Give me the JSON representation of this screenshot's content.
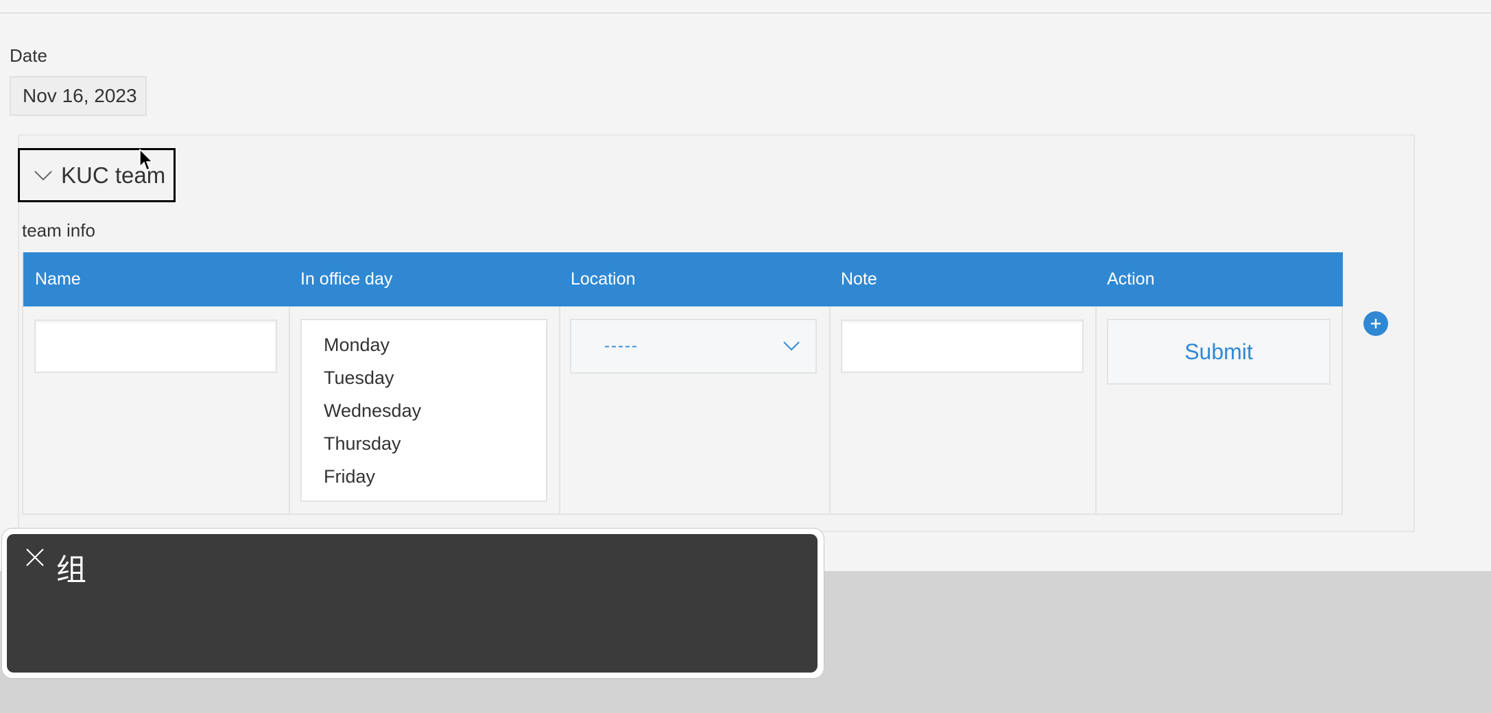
{
  "form": {
    "date_label": "Date",
    "date_value": "Nov 16, 2023"
  },
  "group": {
    "title": "KUC team",
    "expanded": true,
    "section_label": "team info"
  },
  "table": {
    "headers": [
      "Name",
      "In office day",
      "Location",
      "Note",
      "Action"
    ],
    "row": {
      "name_value": "",
      "office_day_options": [
        "Monday",
        "Tuesday",
        "Wednesday",
        "Thursday",
        "Friday"
      ],
      "location_selected": "-----",
      "note_value": "",
      "action_label": "Submit"
    }
  },
  "ime_popup": {
    "candidate_text": "组"
  },
  "colors": {
    "header_bg": "#3088d3",
    "accent": "#3088d3",
    "page_bg": "#f4f4f4",
    "popup_bg": "#3b3b3b"
  }
}
